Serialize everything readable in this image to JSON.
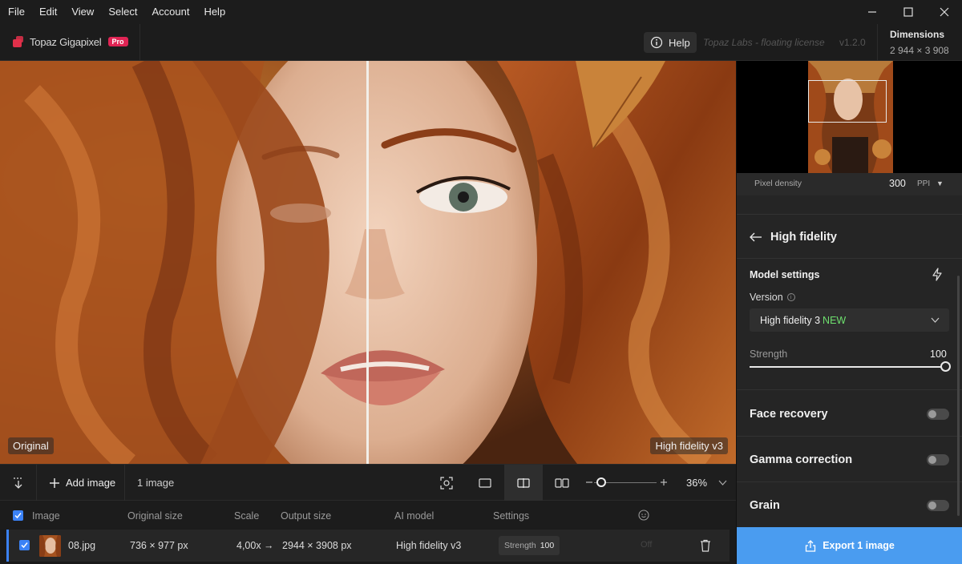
{
  "menu": [
    "File",
    "Edit",
    "View",
    "Select",
    "Account",
    "Help"
  ],
  "header": {
    "app_name": "Topaz Gigapixel",
    "badge": "Pro",
    "help_label": "Help",
    "license": "Topaz Labs - floating license",
    "version": "v1.2.0",
    "dimensions_title": "Dimensions",
    "dimensions_value": "2 944 × 3 908"
  },
  "canvas": {
    "left_label": "Original",
    "right_label": "High fidelity v3"
  },
  "toolbar": {
    "add_label": "Add image",
    "count": "1 image",
    "zoom": "36%"
  },
  "table": {
    "headers": [
      "Image",
      "Original size",
      "Scale",
      "Output size",
      "AI model",
      "Settings"
    ],
    "row": {
      "filename": "08.jpg",
      "original_size": "736 × 977 px",
      "scale": "4,00x →",
      "output_size": "2944 × 3908 px",
      "model": "High fidelity v3",
      "strength_label": "Strength",
      "strength_value": "100",
      "face": "Off"
    }
  },
  "panel": {
    "pixel_density_label": "Pixel density",
    "pixel_density_value": "300",
    "pixel_density_unit": "PPI",
    "model_title": "High fidelity",
    "model_settings": "Model settings",
    "version_label": "Version",
    "version_value": "High fidelity 3",
    "version_badge": "NEW",
    "strength_label": "Strength",
    "strength_value": "100",
    "face_recovery": "Face recovery",
    "gamma_correction": "Gamma correction",
    "grain": "Grain",
    "export_label": "Export 1 image"
  },
  "colors": {
    "accent": "#3b82f6",
    "export": "#4a9cf0",
    "badge": "#e02454",
    "new_tag": "#6ee06e"
  }
}
